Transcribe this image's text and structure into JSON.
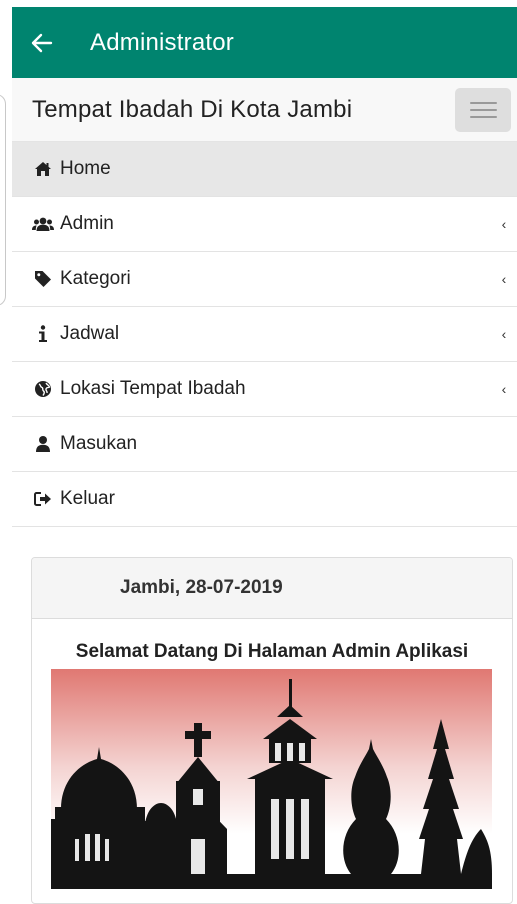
{
  "appbar": {
    "title": "Administrator",
    "back_icon": "arrow-left-icon",
    "color": "#00846f"
  },
  "navbar": {
    "brand": "Tempat Ibadah Di Kota Jambi",
    "toggle_icon": "hamburger-icon"
  },
  "menu": {
    "items": [
      {
        "label": "Home",
        "icon": "home-icon",
        "active": true,
        "has_submenu": false
      },
      {
        "label": "Admin",
        "icon": "users-icon",
        "active": false,
        "has_submenu": true
      },
      {
        "label": "Kategori",
        "icon": "tag-icon",
        "active": false,
        "has_submenu": true
      },
      {
        "label": "Jadwal",
        "icon": "info-icon",
        "active": false,
        "has_submenu": true
      },
      {
        "label": "Lokasi Tempat Ibadah",
        "icon": "globe-icon",
        "active": false,
        "has_submenu": true
      },
      {
        "label": "Masukan",
        "icon": "user-icon",
        "active": false,
        "has_submenu": false
      },
      {
        "label": "Keluar",
        "icon": "logout-icon",
        "active": false,
        "has_submenu": false
      }
    ],
    "caret": "‹"
  },
  "panel": {
    "heading": "Jambi, 28-07-2019",
    "welcome": "Selamat Datang Di Halaman Admin Aplikasi",
    "banner_icon": "places-of-worship-silhouette"
  }
}
